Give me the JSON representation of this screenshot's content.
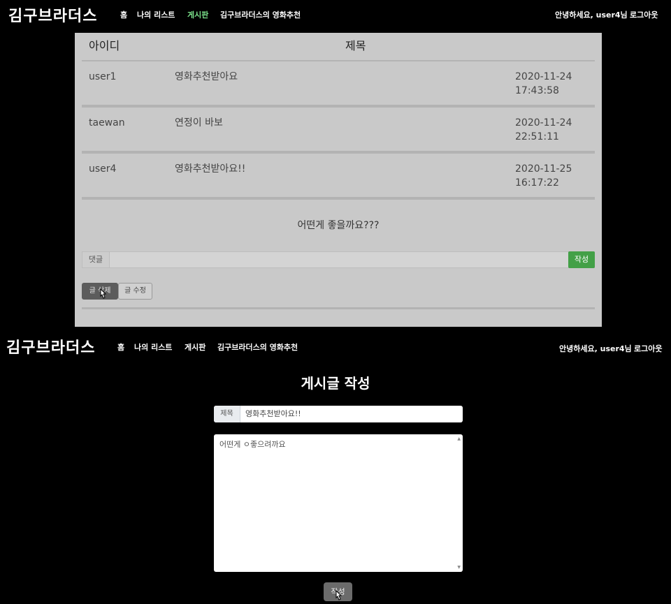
{
  "nav_top": {
    "brand": "김구브라더스",
    "items": [
      "홈",
      "나의 리스트",
      "게시판",
      "김구브라더스의 영화추천"
    ],
    "greeting": "안녕하세요, user4님",
    "logout": "로그아웃"
  },
  "board": {
    "headers": {
      "id": "아이디",
      "title": "제목"
    },
    "rows": [
      {
        "id": "user1",
        "title": "영화추천받아요",
        "date": "2020-11-24",
        "time": "17:43:58"
      },
      {
        "id": "taewan",
        "title": "연정이 바보",
        "date": "2020-11-24",
        "time": "22:51:11"
      },
      {
        "id": "user4",
        "title": "영화추천받아요!!",
        "date": "2020-11-25",
        "time": "16:17:22"
      }
    ],
    "content": "어떤게 좋을까요???",
    "comment_label": "댓글",
    "comment_submit": "작성",
    "delete_button": "글 삭제",
    "edit_button": "글 수정"
  },
  "nav_bottom": {
    "brand": "김구브라더스",
    "items": [
      "홈",
      "나의 리스트",
      "게시판",
      "김구브라더스의 영화추천"
    ],
    "greeting": "안녕하세요, user4님",
    "logout": "로그아웃"
  },
  "write": {
    "heading": "게시글 작성",
    "title_label": "제목",
    "title_value": "영화추천받아요!!",
    "body_value": "어떤게 ㅇ좋으려까요",
    "submit": "작성"
  },
  "colors": {
    "active_nav": "#7be28b",
    "submit_green": "#43a047"
  },
  "icons": [
    "mouse-cursor-icon",
    "scroll-up-icon",
    "scroll-down-icon"
  ]
}
